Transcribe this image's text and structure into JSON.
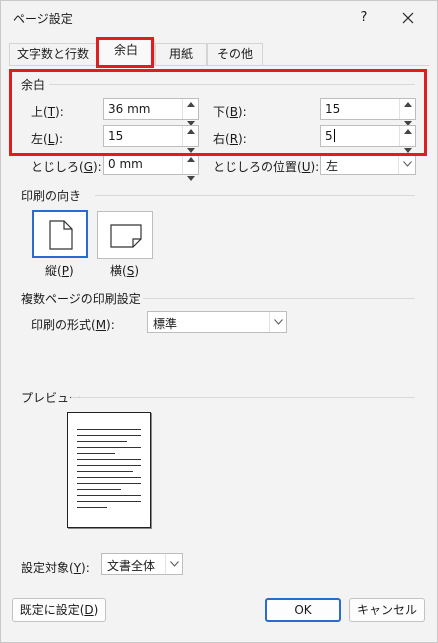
{
  "window": {
    "title": "ページ設定",
    "help_label": "?",
    "close_icon": "close-icon"
  },
  "tabs": [
    {
      "label": "文字数と行数"
    },
    {
      "label": "余白"
    },
    {
      "label": "用紙"
    },
    {
      "label": "その他"
    }
  ],
  "margins": {
    "title": "余白",
    "top": {
      "label": "上(T):",
      "value": "36 mm"
    },
    "bottom": {
      "label": "下(B):",
      "value": "15"
    },
    "left": {
      "label": "左(L):",
      "value": "15"
    },
    "right": {
      "label": "右(R):",
      "value": "5"
    },
    "gutter": {
      "label": "とじしろ(G):",
      "value": "0 mm"
    },
    "gutter_position": {
      "label": "とじしろの位置(U):",
      "value": "左"
    }
  },
  "orientation": {
    "title": "印刷の向き",
    "portrait": {
      "label": "縦(P)",
      "selected": true
    },
    "landscape": {
      "label": "横(S)",
      "selected": false
    }
  },
  "pages": {
    "title": "複数ページの印刷設定",
    "print_format": {
      "label": "印刷の形式(M):",
      "value": "標準"
    }
  },
  "preview": {
    "title": "プレビュー"
  },
  "apply_to": {
    "label": "設定対象(Y):",
    "value": "文書全体"
  },
  "buttons": {
    "default": "既定に設定(D)",
    "ok": "OK",
    "cancel": "キャンセル"
  },
  "colors": {
    "highlight": "#e01c1c",
    "accent": "#2a6bd1"
  }
}
